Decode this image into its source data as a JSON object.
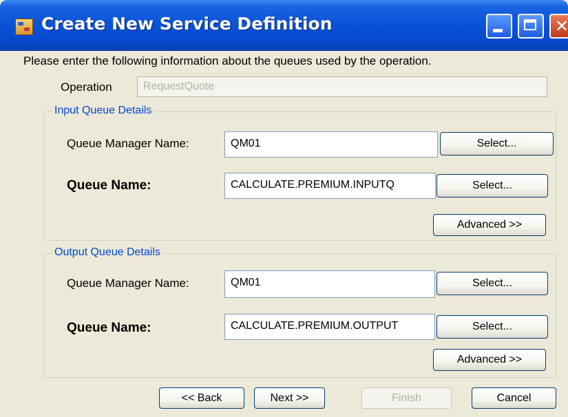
{
  "window": {
    "title": "Create New Service Definition"
  },
  "instructions": "Please enter the following information about the queues used by the operation.",
  "operation": {
    "label": "Operation",
    "value": "RequestQuote"
  },
  "input_queue": {
    "group_title": "Input Queue Details",
    "qm_label": "Queue Manager Name:",
    "qm_value": "QM01",
    "qm_select": "Select...",
    "queue_label": "Queue Name:",
    "queue_value": "CALCULATE.PREMIUM.INPUTQ",
    "queue_select": "Select...",
    "advanced": "Advanced >>"
  },
  "output_queue": {
    "group_title": "Output Queue Details",
    "qm_label": "Queue Manager Name:",
    "qm_value": "QM01",
    "qm_select": "Select...",
    "queue_label": "Queue Name:",
    "queue_value": "CALCULATE.PREMIUM.OUTPUT",
    "queue_select": "Select...",
    "advanced": "Advanced >>"
  },
  "footer": {
    "back": "<< Back",
    "next": "Next >>",
    "finish": "Finish",
    "cancel": "Cancel"
  },
  "icons": [
    "app-icon",
    "minimize-icon",
    "maximize-icon",
    "close-icon"
  ],
  "colors": {
    "titlebar": "#0a52d6",
    "group_title": "#0046d5",
    "dialog_bg": "#ece9d8"
  }
}
